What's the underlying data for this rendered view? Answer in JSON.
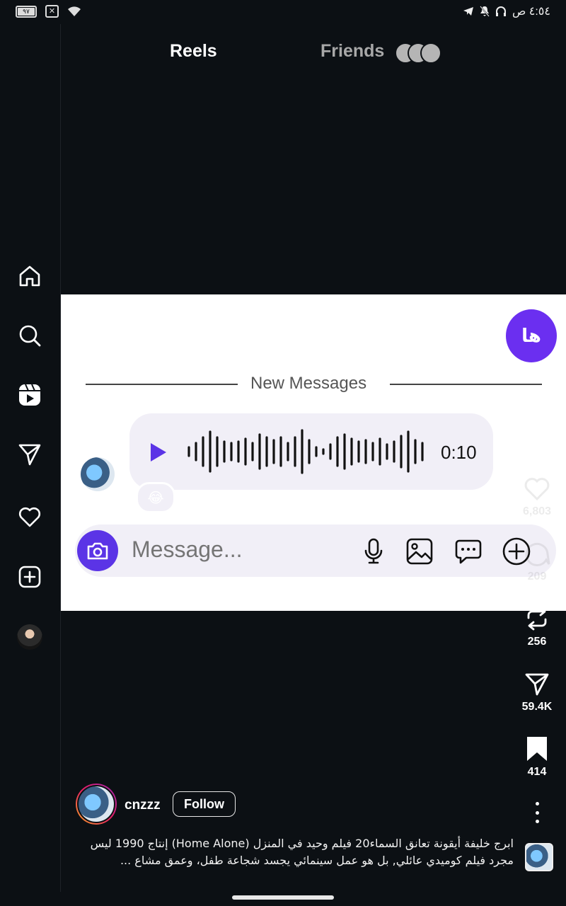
{
  "status_bar": {
    "time": "٤:٥٤ ص",
    "battery": "٩٧",
    "icons": [
      "telegram-icon",
      "mute-icon",
      "headphones-icon",
      "wifi-icon",
      "close-box-icon",
      "battery-icon"
    ]
  },
  "tabs": [
    {
      "label": "Reels",
      "active": true
    },
    {
      "label": "Friends",
      "active": false
    }
  ],
  "sidebar": {
    "items": [
      "home-icon",
      "search-icon",
      "reels-icon",
      "direct-icon",
      "heart-icon",
      "create-icon",
      "profile-avatar"
    ]
  },
  "video": {
    "sender_badge": "ها",
    "divider_text": "New Messages",
    "voice_message": {
      "duration": "0:10"
    },
    "reaction": "😂",
    "composer": {
      "placeholder": "Message..."
    }
  },
  "actions": {
    "likes": "6,803",
    "comments": "209",
    "reposts": "256",
    "shares": "59.4K",
    "saves": "414"
  },
  "post": {
    "username": "cnzzz",
    "follow_label": "Follow",
    "caption": "ابرج خليفة أيقونة تعانق السماء20 فيلم وحيد في المنزل (Home Alone) إنتاج 1990 ليس مجرد فيلم كوميدي عائلي, بل هو عمل سينمائي يجسد شجاعة طفل، وعمق مشاع ..."
  },
  "colors": {
    "background": "#0c1014",
    "accent_purple": "#5b34e6",
    "badge_purple": "#6b2ff0"
  }
}
